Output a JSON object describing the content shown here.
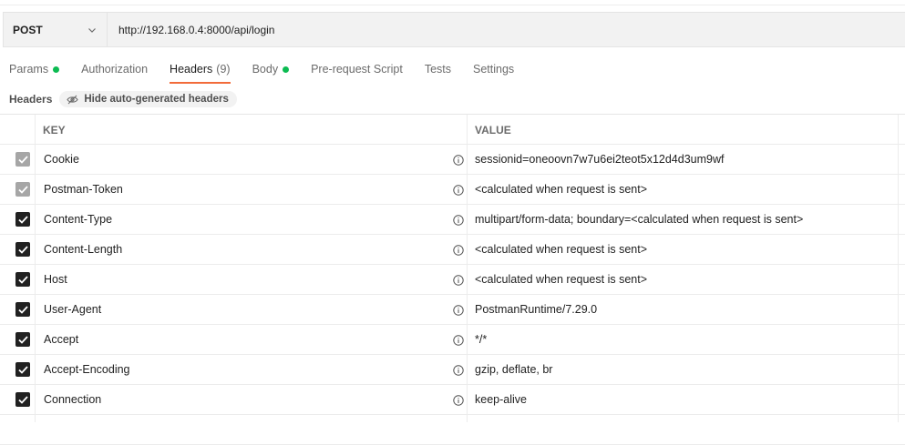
{
  "request": {
    "method": "POST",
    "url": "http://192.168.0.4:8000/api/login"
  },
  "tabs": [
    {
      "label": "Params",
      "dot": true
    },
    {
      "label": "Authorization"
    },
    {
      "label": "Headers",
      "count": "(9)",
      "active": true
    },
    {
      "label": "Body",
      "dot": true
    },
    {
      "label": "Pre-request Script"
    },
    {
      "label": "Tests"
    },
    {
      "label": "Settings"
    }
  ],
  "subbar": {
    "label": "Headers",
    "toggle_label": "Hide auto-generated headers"
  },
  "table": {
    "key_header": "KEY",
    "value_header": "VALUE",
    "rows": [
      {
        "key": "Cookie",
        "value": "sessionid=oneoovn7w7u6ei2teot5x12d4d3um9wf",
        "checked": true,
        "disabled": true
      },
      {
        "key": "Postman-Token",
        "value": "<calculated when request is sent>",
        "checked": true,
        "disabled": true
      },
      {
        "key": "Content-Type",
        "value": "multipart/form-data; boundary=<calculated when request is sent>",
        "checked": true
      },
      {
        "key": "Content-Length",
        "value": "<calculated when request is sent>",
        "checked": true
      },
      {
        "key": "Host",
        "value": "<calculated when request is sent>",
        "checked": true
      },
      {
        "key": "User-Agent",
        "value": "PostmanRuntime/7.29.0",
        "checked": true
      },
      {
        "key": "Accept",
        "value": "*/*",
        "checked": true
      },
      {
        "key": "Accept-Encoding",
        "value": "gzip, deflate, br",
        "checked": true
      },
      {
        "key": "Connection",
        "value": "keep-alive",
        "checked": true
      }
    ]
  },
  "colors": {
    "accent": "#f26b3a",
    "status_dot": "#0cbb52",
    "checkbox": "#212121",
    "checkbox_disabled": "#a6a6a6"
  }
}
